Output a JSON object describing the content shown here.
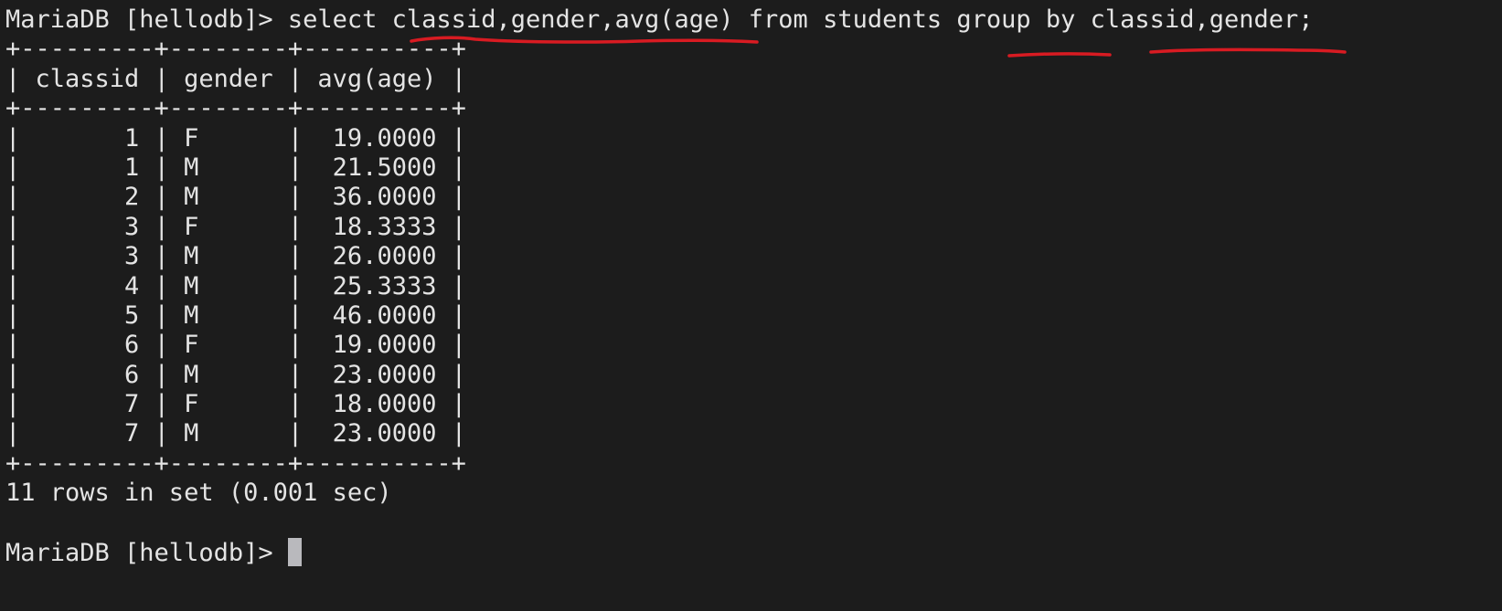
{
  "prompt": "MariaDB [hellodb]>",
  "query": "select classid,gender,avg(age) from students group by classid,gender;",
  "table": {
    "border": "+---------+--------+----------+",
    "columns": [
      "classid",
      "gender",
      "avg(age)"
    ],
    "rows": [
      [
        "1",
        "F",
        "19.0000"
      ],
      [
        "1",
        "M",
        "21.5000"
      ],
      [
        "2",
        "M",
        "36.0000"
      ],
      [
        "3",
        "F",
        "18.3333"
      ],
      [
        "3",
        "M",
        "26.0000"
      ],
      [
        "4",
        "M",
        "25.3333"
      ],
      [
        "5",
        "M",
        "46.0000"
      ],
      [
        "6",
        "F",
        "19.0000"
      ],
      [
        "6",
        "M",
        "23.0000"
      ],
      [
        "7",
        "F",
        "18.0000"
      ],
      [
        "7",
        "M",
        "23.0000"
      ]
    ]
  },
  "result_summary": "11 rows in set (0.001 sec)",
  "colors": {
    "background": "#1c1c1c",
    "text": "#e4e4e4",
    "cursor": "#b9b9bd",
    "annotation": "#d81b22"
  }
}
